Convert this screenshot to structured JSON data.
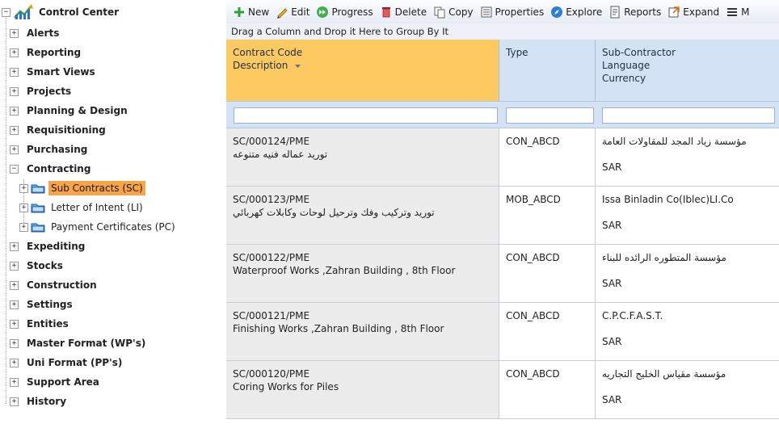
{
  "tree": {
    "root_label": "Control Center",
    "items": [
      {
        "label": "Alerts"
      },
      {
        "label": "Reporting"
      },
      {
        "label": "Smart Views"
      },
      {
        "label": "Projects"
      },
      {
        "label": "Planning & Design"
      },
      {
        "label": "Requisitioning"
      },
      {
        "label": "Purchasing"
      },
      {
        "label": "Contracting"
      },
      {
        "label": "Expediting"
      },
      {
        "label": "Stocks"
      },
      {
        "label": "Construction"
      },
      {
        "label": "Settings"
      },
      {
        "label": "Entities"
      },
      {
        "label": "Master Format (WP's)"
      },
      {
        "label": "Uni Format (PP's)"
      },
      {
        "label": "Support Area"
      },
      {
        "label": "History"
      }
    ],
    "contracting_children": [
      {
        "label": "Sub Contracts (SC)",
        "selected": true
      },
      {
        "label": "Letter of Intent (LI)",
        "selected": false
      },
      {
        "label": "Payment Certificates (PC)",
        "selected": false
      }
    ],
    "selection_color": "#f7a347"
  },
  "toolbar": {
    "buttons": [
      {
        "label": "New",
        "icon": "plus-icon"
      },
      {
        "label": "Edit",
        "icon": "pencil-icon"
      },
      {
        "label": "Progress",
        "icon": "forward-icon"
      },
      {
        "label": "Delete",
        "icon": "trash-icon"
      },
      {
        "label": "Copy",
        "icon": "copy-icon"
      },
      {
        "label": "Properties",
        "icon": "properties-icon"
      },
      {
        "label": "Explore",
        "icon": "compass-icon"
      },
      {
        "label": "Reports",
        "icon": "report-icon"
      },
      {
        "label": "Expand",
        "icon": "expand-icon"
      },
      {
        "label": "M",
        "icon": "menu-icon"
      }
    ]
  },
  "group_panel": {
    "text": "Drag a Column and Drop it Here to Group By It"
  },
  "grid": {
    "headers": [
      {
        "lines": [
          "Contract Code",
          "Description"
        ],
        "sorted": true
      },
      {
        "lines": [
          "Type"
        ],
        "sorted": false
      },
      {
        "lines": [
          "Sub-Contractor",
          "Language",
          "Currency"
        ],
        "sorted": false
      }
    ],
    "rows": [
      {
        "code": "SC/000124/PME",
        "description": "توريد عماله فنيه متنوعه",
        "type": "CON_ABCD",
        "subcontractor": "مؤسسة زياد المجد للمقاولات العامة",
        "currency": "SAR"
      },
      {
        "code": "SC/000123/PME",
        "description": "توريد وتركيب وفك وترحيل لوحات وكابلات كهربائي",
        "type": "MOB_ABCD",
        "subcontractor": "Issa Binladin Co(Iblec)LI.Co",
        "currency": "SAR"
      },
      {
        "code": "SC/000122/PME",
        "description": "Waterproof Works ,Zahran Building , 8th Floor",
        "type": "CON_ABCD",
        "subcontractor": "مؤسسة المتطوره الرائده للبناء",
        "currency": "SAR"
      },
      {
        "code": "SC/000121/PME",
        "description": "Finishing Works ,Zahran Building , 8th Floor",
        "type": "CON_ABCD",
        "subcontractor": "C.P.C.F.A.S.T.",
        "currency": "SAR"
      },
      {
        "code": "SC/000120/PME",
        "description": "Coring Works for Piles",
        "type": "CON_ABCD",
        "subcontractor": "مؤسسة مقياس الخليج التجاريه",
        "currency": "SAR"
      }
    ]
  }
}
